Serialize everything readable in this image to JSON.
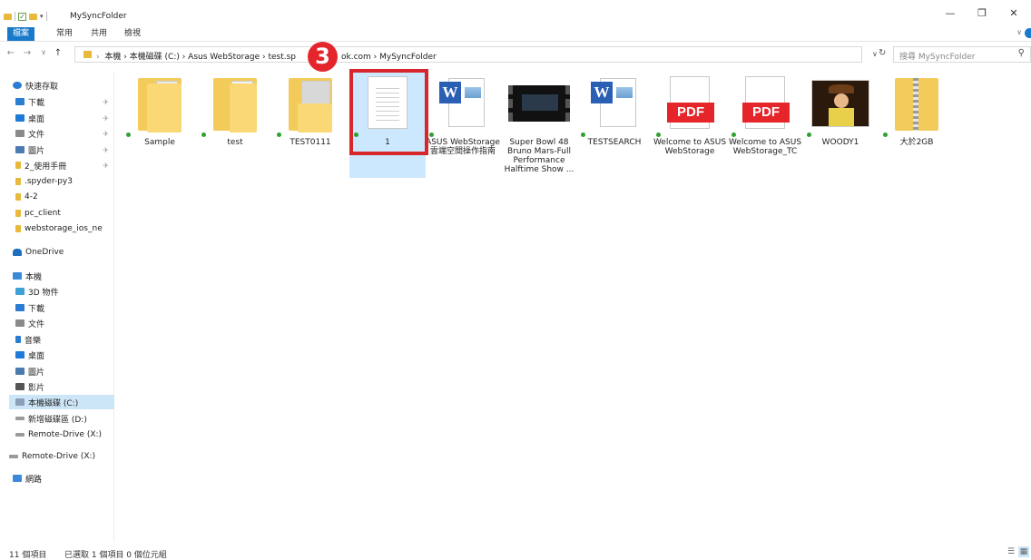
{
  "window": {
    "title": "MySyncFolder",
    "controls": {
      "minimize": "—",
      "maximize": "❐",
      "close": "✕"
    }
  },
  "ribbon": {
    "tabs": [
      {
        "label": "檔案"
      },
      {
        "label": "常用"
      },
      {
        "label": "共用"
      },
      {
        "label": "檢視"
      }
    ]
  },
  "address": {
    "path": "本機  ›  本機磁碟 (C:)  ›  Asus WebStorage  ›  test.sp",
    "path_tail": "ok.com  ›  MySyncFolder",
    "search_placeholder": "搜尋 MySyncFolder"
  },
  "sidebar": {
    "items": [
      {
        "label": "快速存取",
        "color": "#2b7cd3",
        "pinned": false
      },
      {
        "label": "下載",
        "color": "#2b7cd3",
        "pinned": true
      },
      {
        "label": "桌面",
        "color": "#1e7ad6",
        "pinned": true
      },
      {
        "label": "文件",
        "color": "#8a8a8a",
        "pinned": true
      },
      {
        "label": "圖片",
        "color": "#4a7ab0",
        "pinned": true
      },
      {
        "label": "2_使用手冊",
        "color": "#e8b93a",
        "pinned": true
      },
      {
        "label": ".spyder-py3",
        "color": "#e8b93a",
        "pinned": false
      },
      {
        "label": "4-2",
        "color": "#e8b93a",
        "pinned": false
      },
      {
        "label": "pc_client",
        "color": "#e8b93a",
        "pinned": false
      },
      {
        "label": "webstorage_ios_ne",
        "color": "#e8b93a",
        "pinned": false
      },
      {
        "label": "OneDrive",
        "color": "#1f6fc0",
        "pinned": false
      },
      {
        "label": "本機",
        "color": "#3b8ad9",
        "pinned": false
      },
      {
        "label": "3D 物件",
        "color": "#3fa0d8",
        "pinned": false
      },
      {
        "label": "下載",
        "color": "#2b7cd3",
        "pinned": false
      },
      {
        "label": "文件",
        "color": "#8a8a8a",
        "pinned": false
      },
      {
        "label": "音樂",
        "color": "#2b7cd3",
        "pinned": false
      },
      {
        "label": "桌面",
        "color": "#1e7ad6",
        "pinned": false
      },
      {
        "label": "圖片",
        "color": "#4a7ab0",
        "pinned": false
      },
      {
        "label": "影片",
        "color": "#555555",
        "pinned": false
      },
      {
        "label": "本機磁碟 (C:)",
        "color": "#8aa0b8",
        "pinned": false,
        "selected": true
      },
      {
        "label": "新增磁碟區 (D:)",
        "color": "#9a9a9a",
        "pinned": false
      },
      {
        "label": "Remote-Drive (X:)",
        "color": "#9a9a9a",
        "pinned": false
      },
      {
        "label": "Remote-Drive (X:)",
        "color": "#9a9a9a",
        "pinned": false
      },
      {
        "label": "網路",
        "color": "#3b8ad9",
        "pinned": false
      }
    ],
    "pin_glyph": "✈"
  },
  "files": [
    {
      "name": "Sample",
      "type": "folder"
    },
    {
      "name": "test",
      "type": "folder"
    },
    {
      "name": "TEST0111",
      "type": "folder"
    },
    {
      "name": "1",
      "type": "text",
      "selected": true
    },
    {
      "name": "ASUS WebStorage 雲端空間操作指南",
      "type": "word"
    },
    {
      "name": "Super Bowl 48 Bruno Mars-Full Performance Halftime Show ...",
      "type": "video"
    },
    {
      "name": "TESTSEARCH",
      "type": "word"
    },
    {
      "name": "Welcome to ASUS WebStorage",
      "type": "pdf"
    },
    {
      "name": "Welcome to ASUS WebStorage_TC",
      "type": "pdf"
    },
    {
      "name": "WOODY1",
      "type": "image"
    },
    {
      "name": "大於2GB",
      "type": "zip"
    }
  ],
  "annotation": {
    "step_number": "3"
  },
  "pdf_label": "PDF",
  "word_glyph": "W",
  "status": {
    "count": "11 個項目",
    "selected": "已選取 1 個項目  0 個位元組"
  },
  "colors": {
    "accent": "#1979ca",
    "highlight": "#d7262c",
    "selection": "#cce8ff",
    "sync": "#30a030"
  }
}
